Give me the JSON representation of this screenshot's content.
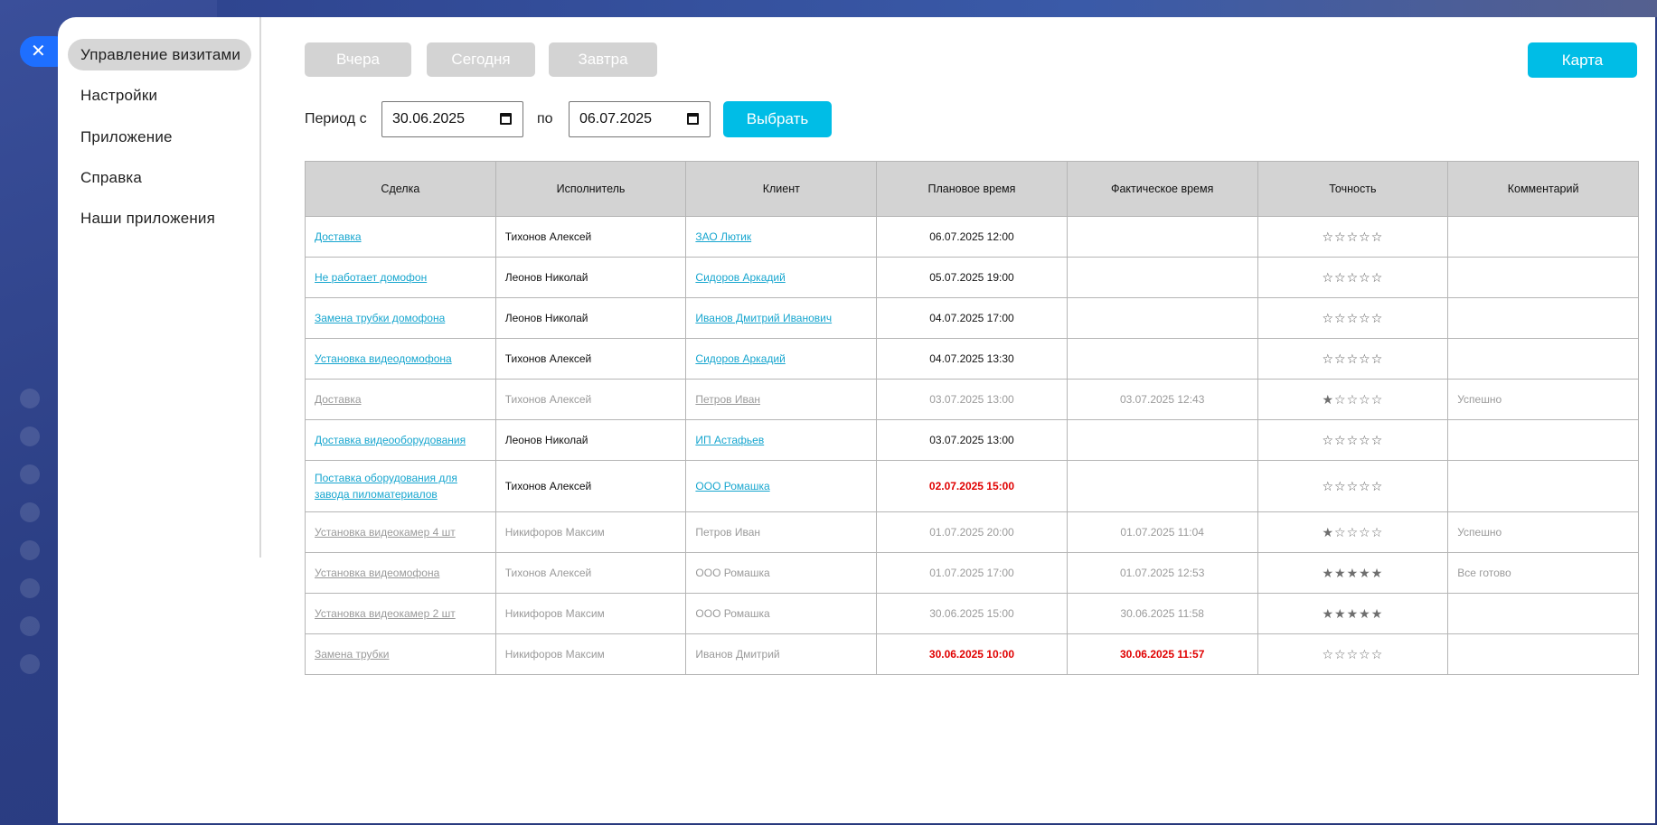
{
  "menu": {
    "items": [
      {
        "label": "Управление визитами",
        "active": true
      },
      {
        "label": "Настройки"
      },
      {
        "label": "Приложение"
      },
      {
        "label": "Справка"
      },
      {
        "label": "Наши приложения"
      }
    ]
  },
  "toolbar": {
    "yesterday": "Вчера",
    "today": "Сегодня",
    "tomorrow": "Завтра",
    "map": "Карта"
  },
  "period": {
    "from_label": "Период с",
    "from": "30.06.2025",
    "to_label": "по",
    "to": "06.07.2025",
    "submit": "Выбрать"
  },
  "table": {
    "headers": [
      "Сделка",
      "Исполнитель",
      "Клиент",
      "Плановое время",
      "Фактическое время",
      "Точность",
      "Комментарий"
    ],
    "rows": [
      {
        "deal": "Доставка",
        "executor": "Тихонов Алексей",
        "client": "ЗАО Лютик",
        "planned": "06.07.2025 12:00",
        "actual": "",
        "rating": 0,
        "comment": "",
        "done": false,
        "client_link": true
      },
      {
        "deal": "Не работает домофон",
        "executor": "Леонов Николай",
        "client": "Сидоров Аркадий",
        "planned": "05.07.2025 19:00",
        "actual": "",
        "rating": 0,
        "comment": "",
        "done": false,
        "client_link": true
      },
      {
        "deal": "Замена трубки домофона",
        "executor": "Леонов Николай",
        "client": "Иванов Дмитрий Иванович",
        "planned": "04.07.2025 17:00",
        "actual": "",
        "rating": 0,
        "comment": "",
        "done": false,
        "client_link": true
      },
      {
        "deal": "Установка видеодомофона",
        "executor": "Тихонов Алексей",
        "client": "Сидоров Аркадий",
        "planned": "04.07.2025 13:30",
        "actual": "",
        "rating": 0,
        "comment": "",
        "done": false,
        "client_link": true
      },
      {
        "deal": "Доставка",
        "executor": "Тихонов Алексей",
        "client": "Петров Иван",
        "planned": "03.07.2025 13:00",
        "actual": "03.07.2025 12:43",
        "rating": 1,
        "comment": "Успешно",
        "done": true,
        "client_link": true
      },
      {
        "deal": "Доставка видеооборудования",
        "executor": "Леонов Николай",
        "client": "ИП Астафьев",
        "planned": "03.07.2025 13:00",
        "actual": "",
        "rating": 0,
        "comment": "",
        "done": false,
        "client_link": true
      },
      {
        "deal": "Поставка оборудования для завода пиломатериалов",
        "executor": "Тихонов Алексей",
        "client": "ООО Ромашка",
        "planned": "02.07.2025 15:00",
        "actual": "",
        "rating": 0,
        "comment": "",
        "done": false,
        "client_link": true,
        "planned_late": true
      },
      {
        "deal": "Установка видеокамер 4 шт",
        "executor": "Никифоров Максим",
        "client": "Петров Иван",
        "planned": "01.07.2025 20:00",
        "actual": "01.07.2025 11:04",
        "rating": 1,
        "comment": "Успешно",
        "done": true,
        "client_link": false
      },
      {
        "deal": "Установка видеомофона",
        "executor": "Тихонов Алексей",
        "client": "ООО Ромашка",
        "planned": "01.07.2025 17:00",
        "actual": "01.07.2025 12:53",
        "rating": 5,
        "comment": "Все готово",
        "done": true,
        "client_link": false
      },
      {
        "deal": "Установка видеокамер 2 шт",
        "executor": "Никифоров Максим",
        "client": "ООО Ромашка",
        "planned": "30.06.2025 15:00",
        "actual": "30.06.2025 11:58",
        "rating": 5,
        "comment": "",
        "done": true,
        "client_link": false
      },
      {
        "deal": "Замена трубки",
        "executor": "Никифоров Максим",
        "client": "Иванов Дмитрий",
        "planned": "30.06.2025 10:00",
        "actual": "30.06.2025 11:57",
        "rating": 0,
        "comment": "",
        "done": true,
        "client_link": false,
        "planned_late": true,
        "actual_late": true
      }
    ]
  },
  "colors": {
    "accent": "#00bde6",
    "link": "#17a6cf",
    "late": "#e00000",
    "close": "#1e6fff"
  }
}
